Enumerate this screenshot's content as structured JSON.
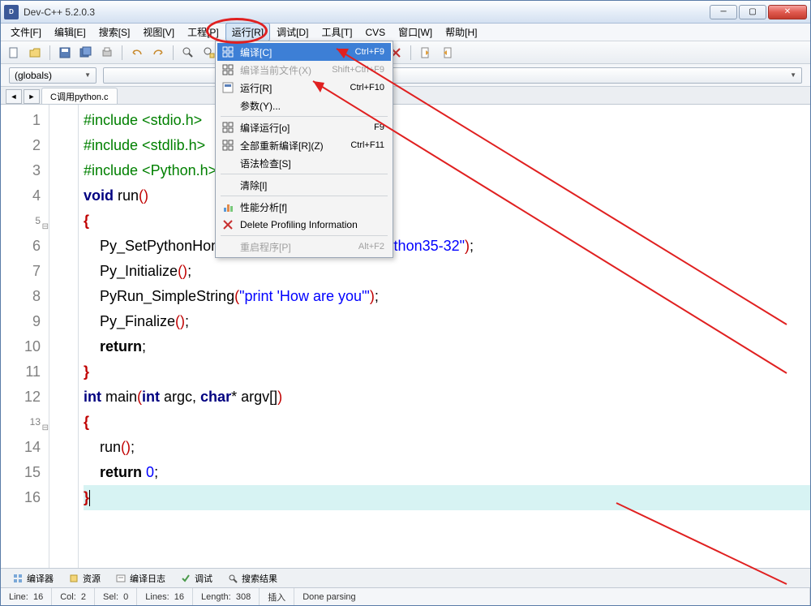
{
  "window": {
    "title": "Dev-C++ 5.2.0.3"
  },
  "menubar": {
    "items": [
      "文件[F]",
      "编辑[E]",
      "搜索[S]",
      "视图[V]",
      "工程[P]",
      "运行[R]",
      "调试[D]",
      "工具[T]",
      "CVS",
      "窗口[W]",
      "帮助[H]"
    ],
    "active_index": 5
  },
  "combos": {
    "globals": "(globals)"
  },
  "tab": {
    "name": "C调用python.c"
  },
  "dropdown": {
    "items": [
      {
        "icon": "grid",
        "label": "编译[C]",
        "shortcut": "Ctrl+F9",
        "sel": true
      },
      {
        "icon": "grid",
        "label": "编译当前文件(X)",
        "shortcut": "Shift+Ctrl+F9",
        "disabled": true
      },
      {
        "icon": "run",
        "label": "运行[R]",
        "shortcut": "Ctrl+F10"
      },
      {
        "icon": "",
        "label": "参数(Y)...",
        "shortcut": ""
      },
      {
        "sep": true
      },
      {
        "icon": "grid",
        "label": "编译运行[o]",
        "shortcut": "F9"
      },
      {
        "icon": "grid",
        "label": "全部重新编译[R](Z)",
        "shortcut": "Ctrl+F11"
      },
      {
        "icon": "",
        "label": "语法检查[S]",
        "shortcut": ""
      },
      {
        "sep": true
      },
      {
        "icon": "",
        "label": "清除[l]",
        "shortcut": ""
      },
      {
        "sep": true
      },
      {
        "icon": "chart",
        "label": "性能分析[f]",
        "shortcut": ""
      },
      {
        "icon": "x",
        "label": "Delete Profiling Information",
        "shortcut": ""
      },
      {
        "sep": true
      },
      {
        "icon": "",
        "label": "重启程序[P]",
        "shortcut": "Alt+F2",
        "disabled": true
      }
    ]
  },
  "code": {
    "lines": [
      {
        "n": 1,
        "html": "<span class='kw-green'>#include &lt;stdio.h&gt;</span>"
      },
      {
        "n": 2,
        "html": "<span class='kw-green'>#include &lt;stdlib.h&gt;</span>"
      },
      {
        "n": 3,
        "html": "<span class='kw-green'>#include &lt;Python.h&gt;</span>"
      },
      {
        "n": 4,
        "html": "<span class='kw-navy'>void</span> run<span class='paren'>()</span>"
      },
      {
        "n": 5,
        "fold": true,
        "html": "<span class='kw-red'>{</span>"
      },
      {
        "n": 6,
        "html": "    Py_SetPythonHome<span class='paren'>(</span><span class='str'>\"C:\\Programs\\Python\\Python35-32\"</span><span class='paren'>)</span>;"
      },
      {
        "n": 7,
        "html": "    Py_Initialize<span class='paren'>()</span>;"
      },
      {
        "n": 8,
        "html": "    PyRun_SimpleString<span class='paren'>(</span><span class='str'>\"print 'How are you'\"</span><span class='paren'>)</span>;"
      },
      {
        "n": 9,
        "html": "    Py_Finalize<span class='paren'>()</span>;"
      },
      {
        "n": 10,
        "html": "    <span class='kw-bold'>return</span>;"
      },
      {
        "n": 11,
        "html": "<span class='kw-red'>}</span>"
      },
      {
        "n": 12,
        "html": "<span class='kw-navy'>int</span> main<span class='paren'>(</span><span class='kw-navy'>int</span> argc, <span class='kw-navy'>char</span>* argv[]<span class='paren'>)</span>"
      },
      {
        "n": 13,
        "fold": true,
        "html": "<span class='kw-red'>{</span>"
      },
      {
        "n": 14,
        "html": "    run<span class='paren'>()</span>;"
      },
      {
        "n": 15,
        "html": "    <span class='kw-bold'>return</span> <span class='str'>0</span>;"
      },
      {
        "n": 16,
        "cursor": true,
        "html": "<span class='kw-red'>}</span>"
      }
    ]
  },
  "bottom_tabs": [
    "编译器",
    "资源",
    "编译日志",
    "调试",
    "搜索结果"
  ],
  "status": {
    "line_label": "Line:",
    "line": "16",
    "col_label": "Col:",
    "col": "2",
    "sel_label": "Sel:",
    "sel": "0",
    "lines_label": "Lines:",
    "lines": "16",
    "length_label": "Length:",
    "length": "308",
    "insert": "插入",
    "parse": "Done parsing"
  }
}
